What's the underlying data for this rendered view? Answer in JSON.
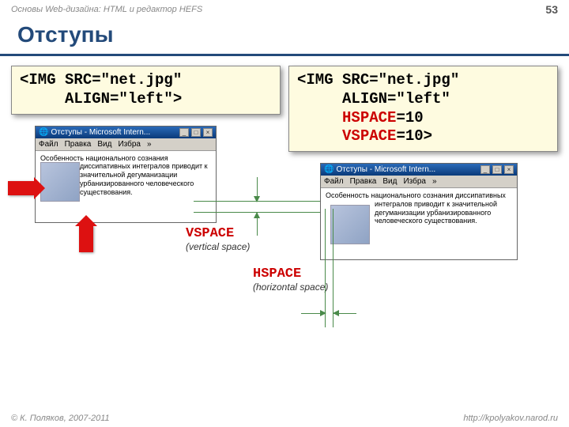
{
  "page": {
    "breadcrumb": "Основы Web-дизайна: HTML и редактор HEFS",
    "number": "53",
    "title": "Отступы"
  },
  "code_left": "<IMG SRC=\"net.jpg\"\n     ALIGN=\"left\">",
  "code_right_plain": "<IMG SRC=\"net.jpg\"\n     ALIGN=\"left\"\n     ",
  "code_right_hspace": "HSPACE",
  "code_right_hval": "=10\n     ",
  "code_right_vspace": "VSPACE",
  "code_right_vval": "=10>",
  "browser": {
    "title": "Отступы - Microsoft Intern...",
    "menu": {
      "file": "Файл",
      "edit": "Правка",
      "view": "Вид",
      "fav": "Избра"
    },
    "text_l1": "Особенность национального",
    "text_l2": "сознания диссипативных",
    "text_l3": "интегралов приводит к значительной дегуманизации урбанизированного человеческого существования."
  },
  "labels": {
    "vspace": "VSPACE",
    "vspace_sub": "(vertical space)",
    "hspace": "HSPACE",
    "hspace_sub": "(horizontal space)"
  },
  "footer": {
    "copyright": "© К. Поляков, 2007-2011",
    "url": "http://kpolyakov.narod.ru"
  }
}
